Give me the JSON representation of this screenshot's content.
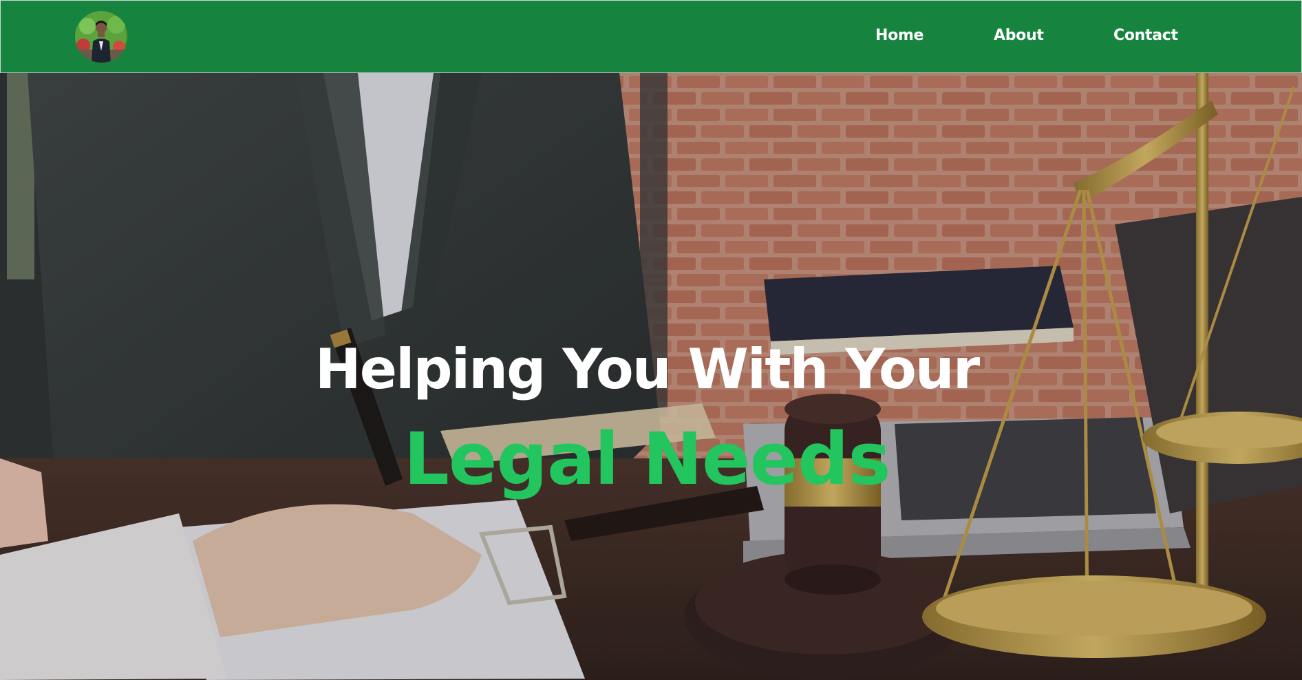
{
  "header": {
    "logo_alt": "Profile photo logo",
    "logo_icon": "profile-avatar",
    "nav": [
      {
        "label": "Home"
      },
      {
        "label": "About"
      },
      {
        "label": "Contact"
      }
    ],
    "background_color": "#16843f"
  },
  "hero": {
    "line1": "Helping You With Your",
    "line2": "Legal Needs",
    "line1_color": "#ffffff",
    "line2_color": "#22c55e",
    "background_image": "Lawyer writing at desk with gavel, laptop and scales of justice"
  }
}
